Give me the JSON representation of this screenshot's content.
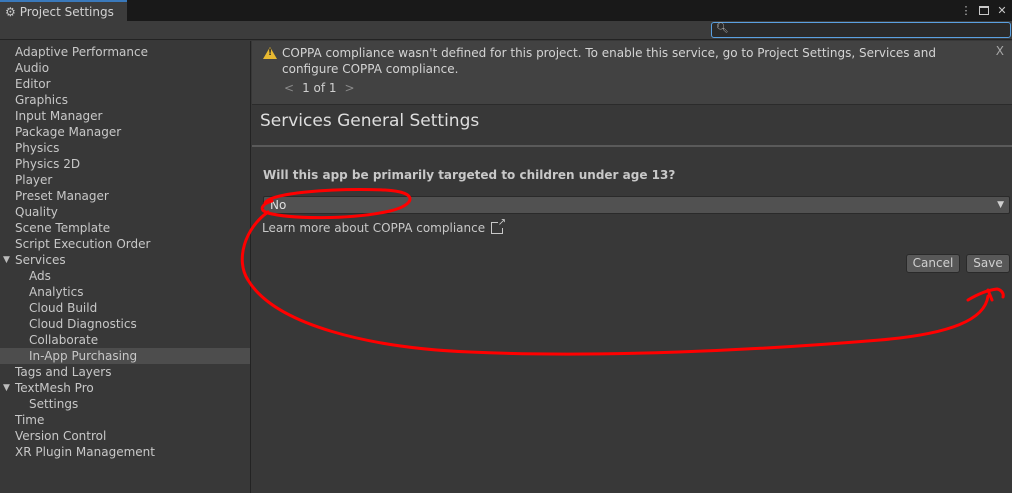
{
  "window": {
    "tab_title": "Project Settings",
    "tab_icon": "gear-icon"
  },
  "search": {
    "value": "",
    "placeholder": ""
  },
  "sidebar": {
    "items": [
      {
        "label": "Adaptive Performance",
        "level": 0
      },
      {
        "label": "Audio",
        "level": 0
      },
      {
        "label": "Editor",
        "level": 0
      },
      {
        "label": "Graphics",
        "level": 0
      },
      {
        "label": "Input Manager",
        "level": 0
      },
      {
        "label": "Package Manager",
        "level": 0
      },
      {
        "label": "Physics",
        "level": 0
      },
      {
        "label": "Physics 2D",
        "level": 0
      },
      {
        "label": "Player",
        "level": 0
      },
      {
        "label": "Preset Manager",
        "level": 0
      },
      {
        "label": "Quality",
        "level": 0
      },
      {
        "label": "Scene Template",
        "level": 0
      },
      {
        "label": "Script Execution Order",
        "level": 0
      },
      {
        "label": "Services",
        "level": 0,
        "expanded": true
      },
      {
        "label": "Ads",
        "level": 1
      },
      {
        "label": "Analytics",
        "level": 1
      },
      {
        "label": "Cloud Build",
        "level": 1
      },
      {
        "label": "Cloud Diagnostics",
        "level": 1
      },
      {
        "label": "Collaborate",
        "level": 1
      },
      {
        "label": "In-App Purchasing",
        "level": 1,
        "selected": true
      },
      {
        "label": "Tags and Layers",
        "level": 0
      },
      {
        "label": "TextMesh Pro",
        "level": 0,
        "expanded": true
      },
      {
        "label": "Settings",
        "level": 1
      },
      {
        "label": "Time",
        "level": 0
      },
      {
        "label": "Version Control",
        "level": 0
      },
      {
        "label": "XR Plugin Management",
        "level": 0
      }
    ]
  },
  "warning": {
    "text": "COPPA compliance wasn't defined for this project. To enable this service, go to Project Settings, Services and configure COPPA compliance.",
    "close_label": "X",
    "pager_prev": "<",
    "pager_text": "1 of 1",
    "pager_next": ">"
  },
  "main": {
    "title": "Services General Settings",
    "question": "Will this app be primarily targeted to children under age 13?",
    "dropdown_value": "No",
    "learn_more": "Learn more about COPPA compliance",
    "cancel_label": "Cancel",
    "save_label": "Save"
  },
  "colors": {
    "accent": "#3a79bb",
    "warning": "#e8b931",
    "annotation": "#ff0000"
  }
}
